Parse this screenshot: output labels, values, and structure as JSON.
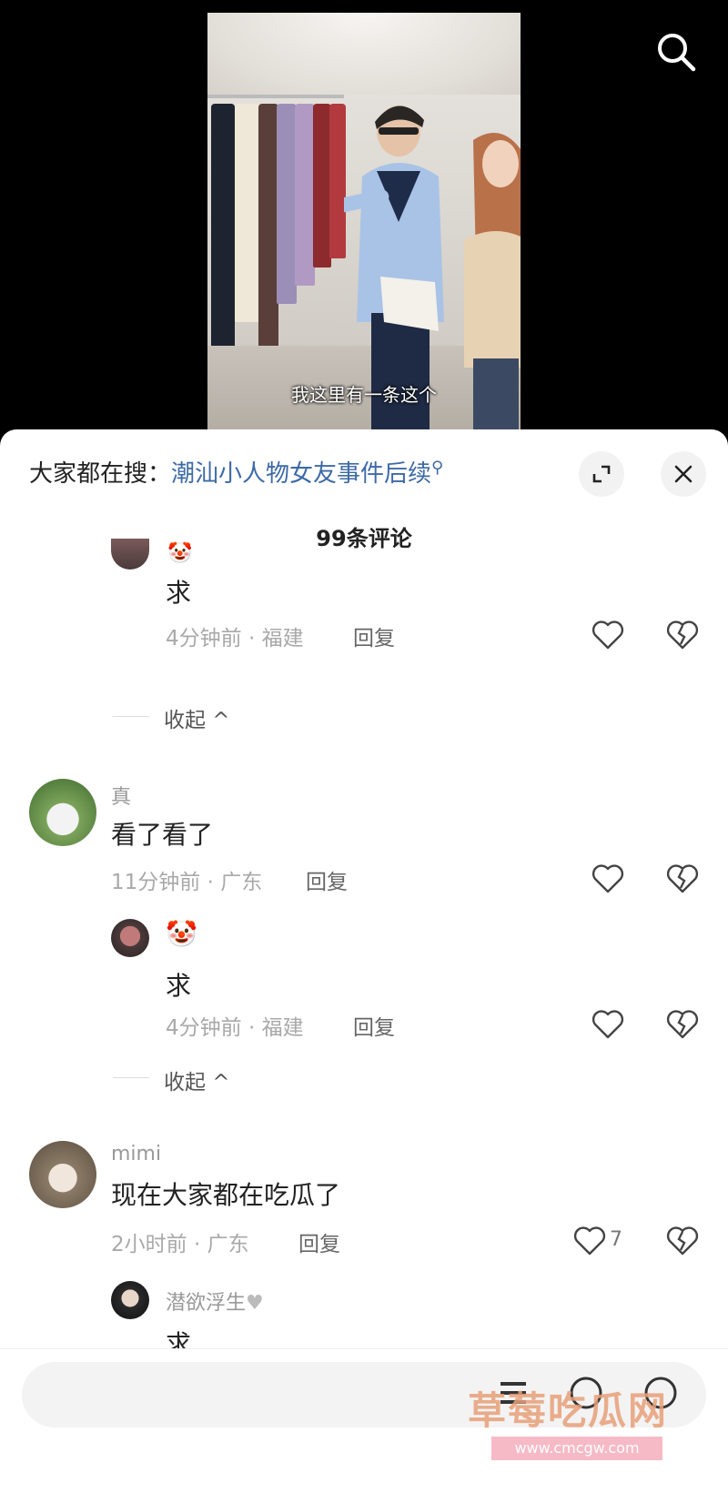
{
  "video": {
    "subtitle": "我这里有一条这个"
  },
  "sheet": {
    "hot_search_prefix": "大家都在搜：",
    "hot_search_keyword": "潮汕小人物女友事件后续",
    "comment_count": "99条评论"
  },
  "comments": {
    "top_reply": {
      "text": "求",
      "meta": "4分钟前 · 福建",
      "reply_label": "回复",
      "collapse_label": "收起"
    },
    "c1": {
      "name": "真",
      "text": "看了看了",
      "meta": "11分钟前 · 广东",
      "reply_label": "回复"
    },
    "c1_reply": {
      "text": "求",
      "meta": "4分钟前 · 福建",
      "reply_label": "回复",
      "collapse_label": "收起"
    },
    "c2": {
      "name": "mimi",
      "text": "现在大家都在吃瓜了",
      "meta": "2小时前 · 广东",
      "reply_label": "回复",
      "likes": "7"
    },
    "c2_reply": {
      "name": "潜欲浮生",
      "text": "求"
    }
  },
  "bottom": {
    "watermark": "草莓吃瓜网",
    "watermark_url": "www.cmcgw.com"
  },
  "colors": {
    "keyword": "#3d6aa6",
    "sheet_bg": "#ffffff",
    "meta": "#a9a9a9"
  },
  "icons": {
    "search": "search-icon",
    "expand": "expand-icon",
    "close": "close-icon",
    "like": "heart-icon",
    "dislike": "broken-heart-icon",
    "chevron": "chevron-up-icon"
  }
}
